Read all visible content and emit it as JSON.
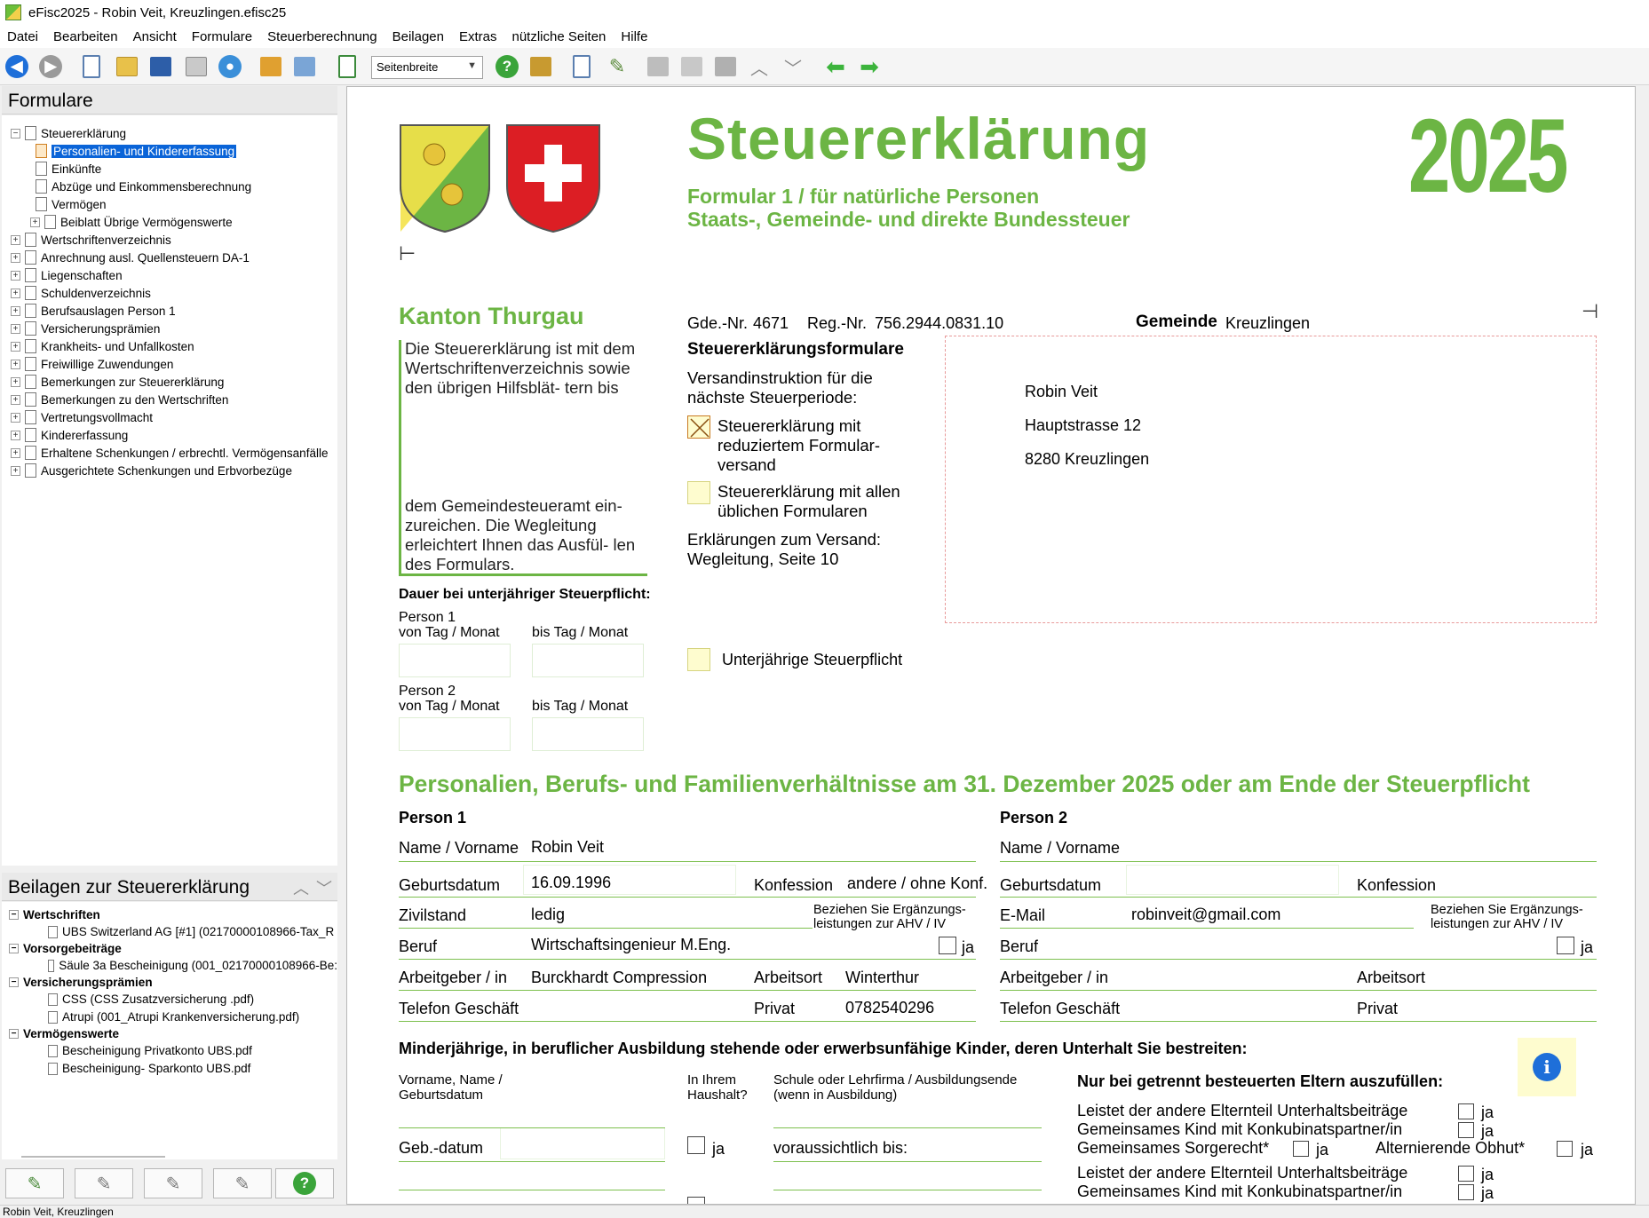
{
  "window": {
    "title": "eFisc2025 - Robin Veit, Kreuzlingen.efisc25"
  },
  "menu": [
    "Datei",
    "Bearbeiten",
    "Ansicht",
    "Formulare",
    "Steuerberechnung",
    "Beilagen",
    "Extras",
    "nützliche Seiten",
    "Hilfe"
  ],
  "toolbar": {
    "zoom": "Seitenbreite"
  },
  "left": {
    "forms_title": "Formulare",
    "tree": [
      "Steuererklärung",
      "Personalien- und Kindererfassung",
      "Einkünfte",
      "Abzüge und Einkommensberechnung",
      "Vermögen",
      "Beiblatt Übrige Vermögenswerte",
      "Wertschriftenverzeichnis",
      "Anrechnung ausl. Quellensteuern DA-1",
      "Liegenschaften",
      "Schuldenverzeichnis",
      "Berufsauslagen Person 1",
      "Versicherungsprämien",
      "Krankheits- und Unfallkosten",
      "Freiwillige Zuwendungen",
      "Bemerkungen zur Steuererklärung",
      "Bemerkungen zu den Wertschriften",
      "Vertretungsvollmacht",
      "Kindererfassung",
      "Erhaltene Schenkungen / erbrechtl. Vermögensanfälle",
      "Ausgerichtete Schenkungen und Erbvorbezüge"
    ],
    "beilagen_title": "Beilagen zur Steuererklärung",
    "beilagen": [
      "Wertschriften",
      "UBS Switzerland AG [#1] (02170000108966-Tax_R",
      "Vorsorgebeiträge",
      "Säule 3a Bescheinigung (001_02170000108966-Be:",
      "Versicherungsprämien",
      "CSS (CSS Zusatzversicherung .pdf)",
      "Atrupi (001_Atrupi Krankenversicherung.pdf)",
      "Vermögenswerte",
      "Bescheinigung Privatkonto UBS.pdf",
      "Bescheinigung- Sparkonto UBS.pdf"
    ]
  },
  "status": "Robin Veit, Kreuzlingen",
  "colors": {
    "accent_green": "#6cb544",
    "year_green": "#6cb544",
    "highlight_yellow": "#fefccf",
    "selection_blue": "#0a64d8"
  },
  "form": {
    "title": "Steuererklärung",
    "subtitle1": "Formular 1 / für natürliche Personen",
    "subtitle2": "Staats-, Gemeinde- und direkte Bundessteuer",
    "year": "2025",
    "kanton": "Kanton Thurgau",
    "intro_text": "Die Steuererklärung ist mit dem Wertschriftenverzeichnis sowie den übrigen Hilfsblät- tern bis",
    "outro_text": "dem Gemeindesteueramt ein- zureichen. Die Wegleitung erleichtert Ihnen das Ausfül- len des Formulars.",
    "gde_label": "Gde.-Nr.",
    "gde_nr": "4671",
    "reg_label": "Reg.-Nr.",
    "reg_nr": "756.2944.0831.10",
    "gemeinde_label": "Gemeinde",
    "gemeinde": "Kreuzlingen",
    "formulare_heading": "Steuererklärungsformulare",
    "versand_text": "Versandinstruktion für die nächste Steuerperiode:",
    "option1": "Steuererklärung mit reduziertem Formular- versand",
    "option2": "Steuererklärung mit allen üblichen Formularen",
    "erklaerung": "Erklärungen zum Versand: Wegleitung, Seite 10",
    "address": [
      "Robin Veit",
      "Hauptstrasse 12",
      "8280 Kreuzlingen"
    ],
    "dauer_heading": "Dauer bei unterjähriger Steuerpflicht:",
    "person1_label": "Person 1",
    "person2_label": "Person 2",
    "von_label": "von Tag / Monat",
    "bis_label": "bis Tag / Monat",
    "unterjaehrig": "Unterjährige Steuerpflicht",
    "section_heading": "Personalien, Berufs- und Familienverhältnisse am 31. Dezember 2025 oder am Ende der Steuerpflicht",
    "p1_heading": "Person 1",
    "p2_heading": "Person 2",
    "labels": {
      "name": "Name / Vorname",
      "geburtsdatum": "Geburtsdatum",
      "konfession": "Konfession",
      "zivilstand": "Zivilstand",
      "email": "E-Mail",
      "ahv": "Beziehen Sie Ergänzungs- leistungen zur AHV / IV",
      "beruf": "Beruf",
      "ja": "ja",
      "arbeitgeber": "Arbeitgeber / in",
      "arbeitsort": "Arbeitsort",
      "telefon": "Telefon Geschäft",
      "privat": "Privat"
    },
    "p1": {
      "name": "Robin Veit",
      "geburtsdatum": "16.09.1996",
      "konfession": "andere / ohne Konf.",
      "zivilstand": "ledig",
      "beruf": "Wirtschaftsingenieur M.Eng.",
      "arbeitgeber": "Burckhardt Compression",
      "arbeitsort": "Winterthur",
      "privat": "0782540296"
    },
    "p2": {
      "email": "robinveit@gmail.com"
    },
    "kinder_heading": "Minderjährige, in beruflicher Ausbildung stehende oder erwerbsunfähige Kinder, deren Unterhalt Sie bestreiten:",
    "kinder_col1": "Vorname, Name / Geburtsdatum",
    "kinder_col2": "In Ihrem Haushalt?",
    "kinder_col3": "Schule oder Lehrfirma / Ausbildungsende (wenn in Ausbildung)",
    "getrennt_heading": "Nur bei getrennt besteuerten Eltern auszufüllen:",
    "getrennt_line1": "Leistet der andere Elternteil Unterhaltsbeiträge",
    "getrennt_line2": "Gemeinsames Kind mit Konkubinatspartner/in",
    "getrennt_line3": "Gemeinsames Sorgerecht*",
    "getrennt_line3b": "Alternierende Obhut*",
    "gebdatum": "Geb.-datum",
    "voraussichtlich": "voraussichtlich bis:"
  }
}
